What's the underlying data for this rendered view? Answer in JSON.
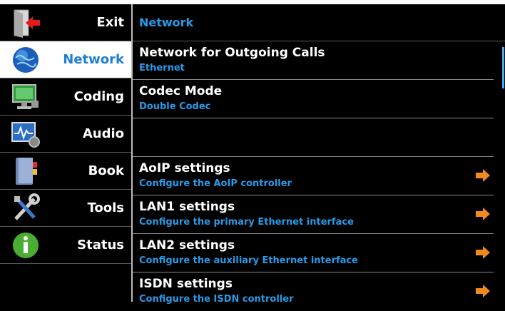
{
  "sidebar": {
    "items": [
      {
        "label": "Exit",
        "icon": "exit-icon"
      },
      {
        "label": "Network",
        "icon": "globe-icon",
        "active": true
      },
      {
        "label": "Coding",
        "icon": "monitor-icon"
      },
      {
        "label": "Audio",
        "icon": "audio-monitor-icon"
      },
      {
        "label": "Book",
        "icon": "book-icon"
      },
      {
        "label": "Tools",
        "icon": "tools-icon"
      },
      {
        "label": "Status",
        "icon": "info-icon"
      }
    ]
  },
  "header": {
    "title": "Network"
  },
  "rows": [
    {
      "title": "Network for Outgoing Calls",
      "subtitle": "Ethernet"
    },
    {
      "title": "Codec Mode",
      "subtitle": "Double Codec"
    },
    {
      "title": "",
      "subtitle": ""
    },
    {
      "title": "AoIP settings",
      "subtitle": "Configure the AoIP controller",
      "arrow": true
    },
    {
      "title": "LAN1 settings",
      "subtitle": "Configure the primary Ethernet interface",
      "arrow": true
    },
    {
      "title": "LAN2 settings",
      "subtitle": "Configure the auxiliary Ethernet interface",
      "arrow": true
    },
    {
      "title": "ISDN settings",
      "subtitle": "Configure the ISDN controller",
      "arrow": true
    }
  ],
  "colors": {
    "accent": "#2a9ae8",
    "arrow": "#f08a1c",
    "active_bg": "#ffffff"
  }
}
